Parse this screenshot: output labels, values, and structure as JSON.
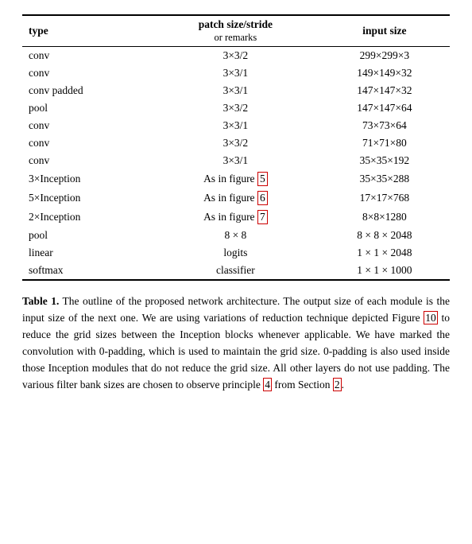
{
  "table": {
    "headers": [
      {
        "label": "type",
        "sub": ""
      },
      {
        "label": "patch size/stride",
        "sub": "or remarks"
      },
      {
        "label": "input size",
        "sub": ""
      }
    ],
    "rows": [
      {
        "type": "conv",
        "patch": "3×3/2",
        "input": "299×299×3"
      },
      {
        "type": "conv",
        "patch": "3×3/1",
        "input": "149×149×32"
      },
      {
        "type": "conv padded",
        "patch": "3×3/1",
        "input": "147×147×32"
      },
      {
        "type": "pool",
        "patch": "3×3/2",
        "input": "147×147×64"
      },
      {
        "type": "conv",
        "patch": "3×3/1",
        "input": "73×73×64"
      },
      {
        "type": "conv",
        "patch": "3×3/2",
        "input": "71×71×80"
      },
      {
        "type": "conv",
        "patch": "3×3/1",
        "input": "35×35×192"
      },
      {
        "type": "3×Inception",
        "patch": "As in figure 5",
        "input": "35×35×288",
        "highlighted": true,
        "highlight_num": "5"
      },
      {
        "type": "5×Inception",
        "patch": "As in figure 6",
        "input": "17×17×768",
        "highlighted": true,
        "highlight_num": "6"
      },
      {
        "type": "2×Inception",
        "patch": "As in figure 7",
        "input": "8×8×1280",
        "highlighted": true,
        "highlight_num": "7"
      },
      {
        "type": "pool",
        "patch": "8 × 8",
        "input": "8 × 8 × 2048"
      },
      {
        "type": "linear",
        "patch": "logits",
        "input": "1 × 1 × 2048"
      },
      {
        "type": "softmax",
        "patch": "classifier",
        "input": "1 × 1 × 1000"
      }
    ]
  },
  "caption": {
    "label": "Table 1.",
    "text": " The outline of the proposed network architecture.  The output size of each module is the input size of the next one.  We are using variations of reduction technique depicted Figure ",
    "ref1": "10",
    "text2": " to reduce the grid sizes between the Inception blocks whenever applicable. We have marked the convolution with 0-padding, which is used to maintain the grid size.  0-padding is also used inside those Inception modules that do not reduce the grid size. All other layers do not use padding. The various filter bank sizes are chosen to observe principle ",
    "ref2": "4",
    "text3": " from Section ",
    "ref3": "2",
    "text4": "."
  }
}
